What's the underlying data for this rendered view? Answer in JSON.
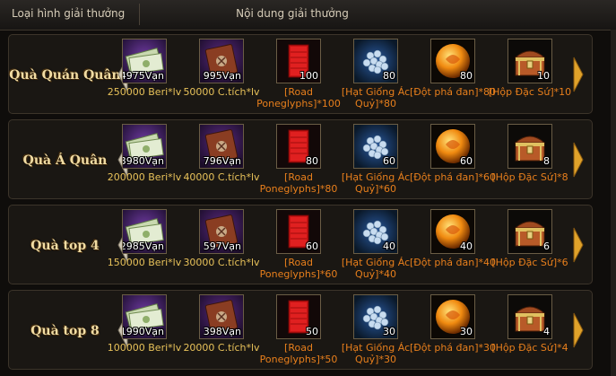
{
  "header": {
    "col_type": "Loại hình giải thưởng",
    "col_content": "Nội dung giải thưởng"
  },
  "colors": {
    "title_gold": "#f1dca3",
    "label_gold": "#e8c25a",
    "label_orange": "#e87f1c"
  },
  "rows": [
    {
      "title": "Quà Quán Quân",
      "items": [
        {
          "icon": "money-icon",
          "qty": "4975Vạn",
          "label": "250000 Beri*lv"
        },
        {
          "icon": "book-icon",
          "qty": "995Vạn",
          "label": "50000 C.tích*lv"
        },
        {
          "icon": "red-book-icon",
          "qty": "100",
          "label": "[Road Poneglyphs]*100"
        },
        {
          "icon": "seeds-icon",
          "qty": "80",
          "label": "[Hạt Giống Ác Quỷ]*80"
        },
        {
          "icon": "orb-icon",
          "qty": "80",
          "label": "[Đột phá đan]*80"
        },
        {
          "icon": "chest-icon",
          "qty": "10",
          "label": "[Hộp Đặc Sứ]*10"
        }
      ]
    },
    {
      "title": "Quà Á Quân",
      "items": [
        {
          "icon": "money-icon",
          "qty": "3980Vạn",
          "label": "200000 Beri*lv"
        },
        {
          "icon": "book-icon",
          "qty": "796Vạn",
          "label": "40000 C.tích*lv"
        },
        {
          "icon": "red-book-icon",
          "qty": "80",
          "label": "[Road Poneglyphs]*80"
        },
        {
          "icon": "seeds-icon",
          "qty": "60",
          "label": "[Hạt Giống Ác Quỷ]*60"
        },
        {
          "icon": "orb-icon",
          "qty": "60",
          "label": "[Đột phá đan]*60"
        },
        {
          "icon": "chest-icon",
          "qty": "8",
          "label": "[Hộp Đặc Sứ]*8"
        }
      ]
    },
    {
      "title": "Quà top 4",
      "items": [
        {
          "icon": "money-icon",
          "qty": "2985Vạn",
          "label": "150000 Beri*lv"
        },
        {
          "icon": "book-icon",
          "qty": "597Vạn",
          "label": "30000 C.tích*lv"
        },
        {
          "icon": "red-book-icon",
          "qty": "60",
          "label": "[Road Poneglyphs]*60"
        },
        {
          "icon": "seeds-icon",
          "qty": "40",
          "label": "[Hạt Giống Ác Quỷ]*40"
        },
        {
          "icon": "orb-icon",
          "qty": "40",
          "label": "[Đột phá đan]*40"
        },
        {
          "icon": "chest-icon",
          "qty": "6",
          "label": "[Hộp Đặc Sứ]*6"
        }
      ]
    },
    {
      "title": "Quà top 8",
      "items": [
        {
          "icon": "money-icon",
          "qty": "1990Vạn",
          "label": "100000 Beri*lv"
        },
        {
          "icon": "book-icon",
          "qty": "398Vạn",
          "label": "20000 C.tích*lv"
        },
        {
          "icon": "red-book-icon",
          "qty": "50",
          "label": "[Road Poneglyphs]*50"
        },
        {
          "icon": "seeds-icon",
          "qty": "30",
          "label": "[Hạt Giống Ác Quỷ]*30"
        },
        {
          "icon": "orb-icon",
          "qty": "30",
          "label": "[Đột phá đan]*30"
        },
        {
          "icon": "chest-icon",
          "qty": "4",
          "label": "[Hộp Đặc Sứ]*4"
        }
      ]
    }
  ]
}
